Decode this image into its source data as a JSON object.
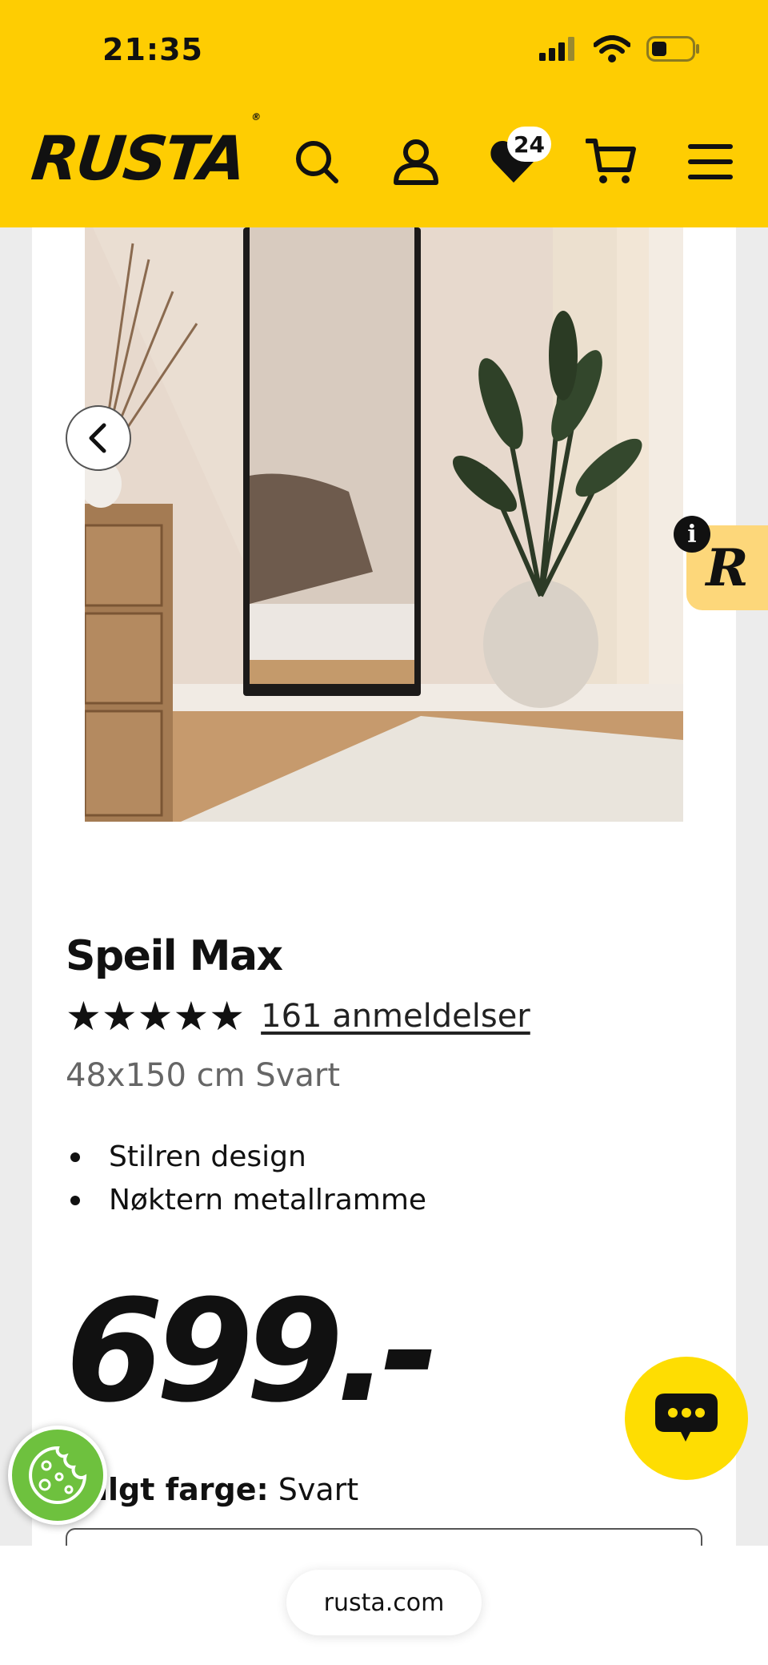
{
  "status_bar": {
    "time": "21:35"
  },
  "header": {
    "logo": "RUSTA",
    "logo_mark": "®",
    "wishlist_count": "24",
    "icons": [
      "search-icon",
      "user-icon",
      "heart-icon",
      "cart-icon",
      "menu-icon"
    ]
  },
  "product": {
    "title": "Speil Max",
    "stars": "★★★★★",
    "rating": 5,
    "reviews_label": "161 anmeldelser",
    "variant": "48x150 cm Svart",
    "features": [
      "Stilren design",
      "Nøktern metallramme"
    ],
    "price": "699.-",
    "color_label": "Valgt farge:",
    "color_value": "Svart"
  },
  "review_widget": {
    "info": "i",
    "logo": "R"
  },
  "browser": {
    "url": "rusta.com"
  },
  "colors": {
    "brand_yellow": "#fecd02",
    "chat_yellow": "#fedd02",
    "cookie_green": "#6ec13e",
    "review_tab": "#fdd77a"
  }
}
